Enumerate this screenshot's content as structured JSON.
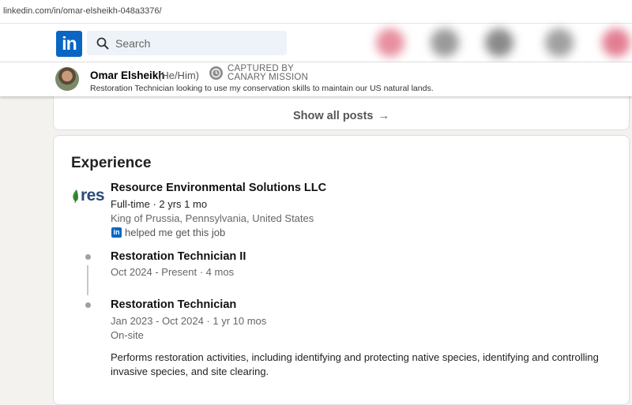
{
  "browser": {
    "url": "linkedin.com/in/omar-elsheikh-048a3376/"
  },
  "nav": {
    "logo_text": "in",
    "search_placeholder": "Search",
    "logo_color": "#0a66c2"
  },
  "profile": {
    "name": "Omar Elsheikh",
    "pronouns": "(He/Him)",
    "badge_line1": "CAPTURED BY",
    "badge_line2": "CANARY MISSION",
    "headline": "Restoration Technician looking to use my conservation skills to maintain our US natural lands."
  },
  "posts": {
    "show_all_label": "Show all posts",
    "arrow": "→"
  },
  "experience": {
    "title": "Experience",
    "company": {
      "logo_text": "res",
      "name": "Resource Environmental Solutions LLC",
      "employment": "Full-time · 2 yrs 1 mo",
      "location": "King of Prussia, Pennsylvania, United States",
      "helped_text": "helped me get this job"
    },
    "roles": [
      {
        "title": "Restoration Technician II",
        "dates": "Oct 2024 - Present · 4 mos"
      },
      {
        "title": "Restoration Technician",
        "dates": "Jan 2023 - Oct 2024 · 1 yr 10 mos",
        "location_type": "On-site",
        "description": "Performs restoration activities, including identifying and protecting native species, identifying and controlling invasive species, and site clearing."
      }
    ]
  },
  "icons": {
    "search": "search-icon",
    "canary": "canary-mission-icon",
    "linkedin_mini": "linkedin-icon",
    "leaf": "leaf-icon"
  }
}
